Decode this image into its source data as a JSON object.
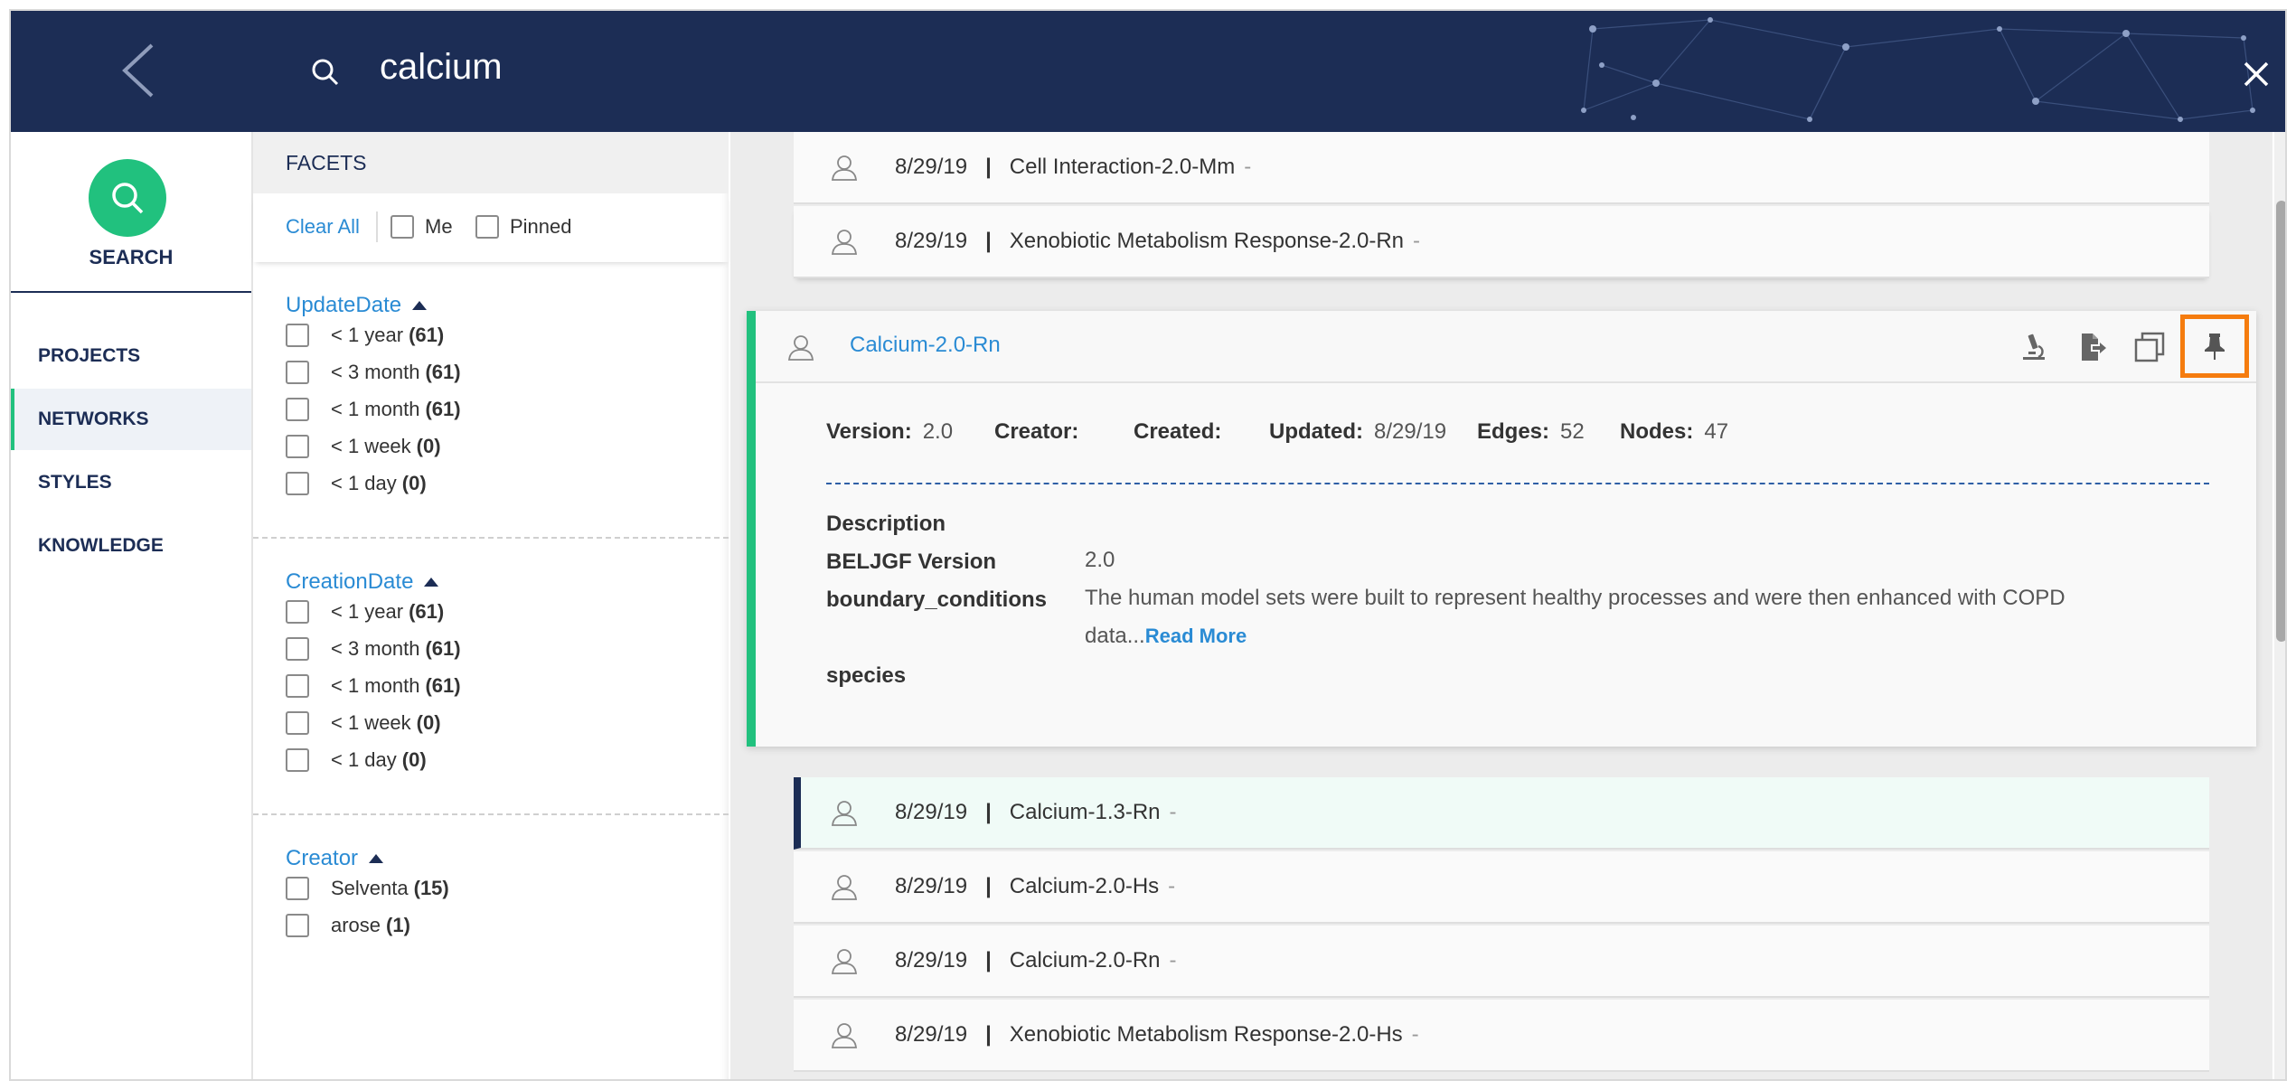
{
  "header": {
    "search_query": "calcium"
  },
  "nav": {
    "search_label": "SEARCH",
    "items": [
      {
        "label": "PROJECTS"
      },
      {
        "label": "NETWORKS"
      },
      {
        "label": "STYLES"
      },
      {
        "label": "KNOWLEDGE"
      }
    ]
  },
  "facets": {
    "heading": "FACETS",
    "clear_all": "Clear All",
    "filter_me": "Me",
    "filter_pinned": "Pinned",
    "groups": [
      {
        "title": "UpdateDate",
        "options": [
          {
            "label": "< 1 year",
            "count": "(61)"
          },
          {
            "label": "< 3 month",
            "count": "(61)"
          },
          {
            "label": "< 1 month",
            "count": "(61)"
          },
          {
            "label": "< 1 week",
            "count": "(0)"
          },
          {
            "label": "< 1 day",
            "count": "(0)"
          }
        ]
      },
      {
        "title": "CreationDate",
        "options": [
          {
            "label": "< 1 year",
            "count": "(61)"
          },
          {
            "label": "< 3 month",
            "count": "(61)"
          },
          {
            "label": "< 1 month",
            "count": "(61)"
          },
          {
            "label": "< 1 week",
            "count": "(0)"
          },
          {
            "label": "< 1 day",
            "count": "(0)"
          }
        ]
      },
      {
        "title": "Creator",
        "options": [
          {
            "label": "Selventa",
            "count": "(15)"
          },
          {
            "label": "arose",
            "count": "(1)"
          }
        ]
      }
    ]
  },
  "results": {
    "separator": "|",
    "dash": "-",
    "top_rows": [
      {
        "date": "8/29/19",
        "name": "Cell Interaction-2.0-Mm"
      },
      {
        "date": "8/29/19",
        "name": "Xenobiotic Metabolism Response-2.0-Rn"
      }
    ],
    "expanded": {
      "title": "Calcium-2.0-Rn",
      "meta": {
        "version_label": "Version:",
        "version": "2.0",
        "creator_label": "Creator:",
        "created_label": "Created:",
        "updated_label": "Updated:",
        "updated": "8/29/19",
        "edges_label": "Edges:",
        "edges": "52",
        "nodes_label": "Nodes:",
        "nodes": "47"
      },
      "props": {
        "description_label": "Description",
        "beljgf_label": "BELJGF Version",
        "beljgf_value": "2.0",
        "boundary_label": "boundary_conditions",
        "boundary_value": "The human model sets were built to represent healthy processes and were then enhanced with COPD data...",
        "read_more": "Read More",
        "species_label": "species"
      },
      "actions": [
        "microscope-icon",
        "export-icon",
        "copy-icon",
        "pin-icon"
      ],
      "accent_color": "#21c17e",
      "pin_highlight_color": "#f57c0e"
    },
    "bottom_rows": [
      {
        "date": "8/29/19",
        "name": "Calcium-1.3-Rn"
      },
      {
        "date": "8/29/19",
        "name": "Calcium-2.0-Hs"
      },
      {
        "date": "8/29/19",
        "name": "Calcium-2.0-Rn"
      },
      {
        "date": "8/29/19",
        "name": "Xenobiotic Metabolism Response-2.0-Hs"
      }
    ]
  },
  "colors": {
    "header_bg": "#1c2d55",
    "link": "#2a8bd4",
    "search_green": "#21c17e"
  }
}
